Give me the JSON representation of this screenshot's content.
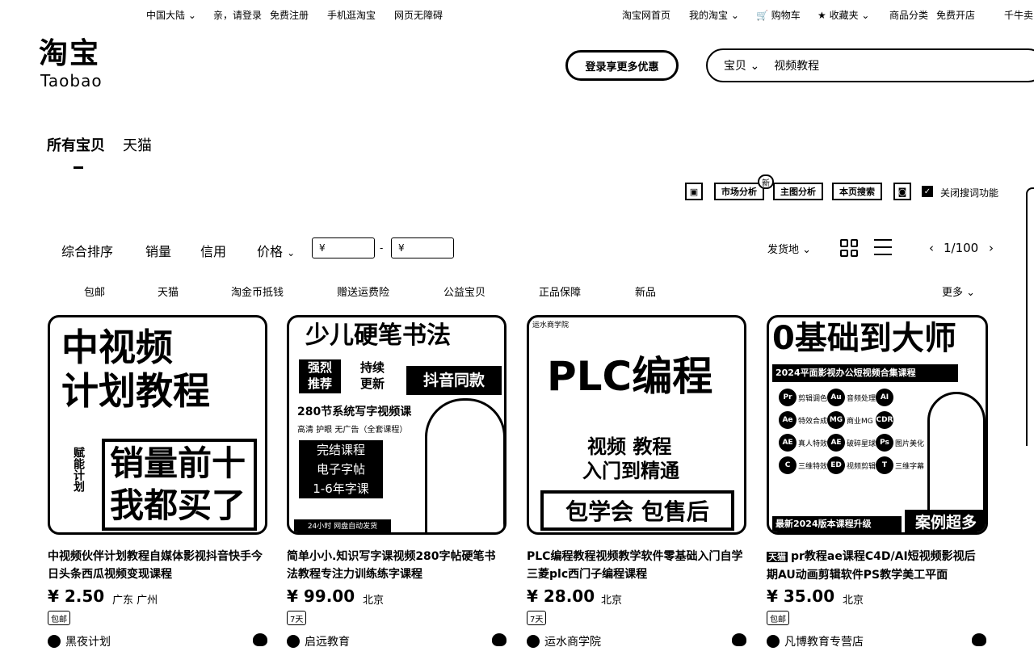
{
  "topbar": {
    "region": "中国大陆",
    "login": "亲，请登录",
    "register": "免费注册",
    "mobile": "手机逛淘宝",
    "accessible": "网页无障碍",
    "home": "淘宝网首页",
    "my": "我的淘宝",
    "cart": "购物车",
    "fav": "收藏夹",
    "cats": "商品分类",
    "open": "免费开店",
    "more": "千牛卖"
  },
  "header": {
    "logo_cn": "淘宝",
    "logo_en": "Taobao",
    "login_pill": "登录享更多优惠",
    "search_scope": "宝贝",
    "search_value": "视频教程"
  },
  "tabs": [
    "所有宝贝",
    "天猫"
  ],
  "tools": {
    "market": "市场分析",
    "new_badge": "新",
    "topic": "主图分析",
    "site_search": "本页搜索",
    "close_words": "关闭搜词功能"
  },
  "sort": {
    "comprehensive": "综合排序",
    "sales": "销量",
    "credit": "信用",
    "price": "价格",
    "price_min_ph": "¥",
    "price_max_ph": "¥",
    "ship_from": "发货地",
    "page": "1/100"
  },
  "filters": [
    "包邮",
    "天猫",
    "淘金币抵钱",
    "赠送运费险",
    "公益宝贝",
    "正品保障",
    "新品"
  ],
  "filters_more": "更多",
  "products": [
    {
      "title": "中视频伙伴计划教程自媒体影视抖音快手今日头条西瓜视频变现课程",
      "price": "¥ 2.50",
      "location": "广东 广州",
      "tag": "包邮",
      "shop": "黑夜计划",
      "img": {
        "line1": "中视频",
        "line2": "计划教程",
        "side": "赋能计划",
        "box1": "销量前十",
        "box2": "我都买了"
      }
    },
    {
      "title": "简单小小.知识写字课视频280字帖硬笔书法教程专注力训练练字课程",
      "price": "¥ 99.00",
      "location": "北京",
      "tag": "7天",
      "shop": "启远教育",
      "img": {
        "head": "少儿硬笔书法",
        "a1": "强烈",
        "a2": "推荐",
        "b1": "持续",
        "b2": "更新",
        "badge": "抖音同款",
        "sub": "280节系统写字视频课",
        "sub2": "高清 护眼 无广告（全套课程）",
        "p1": "完结课程",
        "p2": "电子字帖",
        "p3": "1-6年字课",
        "foot": "24小时 网盘自动发货"
      }
    },
    {
      "title": "PLC编程教程视频教学软件零基础入门自学三菱plc西门子编程课程",
      "price": "¥ 28.00",
      "location": "北京",
      "tag": "7天",
      "shop": "运水商学院",
      "img": {
        "corner": "运水商学院",
        "head": "PLC编程",
        "mid1": "视频 教程",
        "mid2": "入门到精通",
        "foot": "包学会 包售后"
      }
    },
    {
      "title": "pr教程ae课程C4D/AI短视频影视后期AU动画剪辑软件PS教学美工平面",
      "title_badge": "天猫",
      "price": "¥ 35.00",
      "location": "北京",
      "tag": "包邮",
      "shop": "凡博教育专营店",
      "img": {
        "head": "0基础到大师",
        "sub": "2024平面影视办公短视频合集课程",
        "foot": "最新2024版本课程升级",
        "badge": "案例超多",
        "icons": [
          {
            "k": "Pr",
            "l": "剪辑调色"
          },
          {
            "k": "Au",
            "l": "音频处理"
          },
          {
            "k": "AI",
            "l": ""
          },
          {
            "k": "Ae",
            "l": "特效合成"
          },
          {
            "k": "MG",
            "l": "商业MG"
          },
          {
            "k": "CDR",
            "l": ""
          },
          {
            "k": "AE",
            "l": "真人特效"
          },
          {
            "k": "AE",
            "l": "破碎星球"
          },
          {
            "k": "Ps",
            "l": "图片美化"
          },
          {
            "k": "C",
            "l": "三维特效"
          },
          {
            "k": "ED",
            "l": "视频剪辑"
          },
          {
            "k": "T",
            "l": "三维字幕"
          }
        ]
      }
    }
  ]
}
